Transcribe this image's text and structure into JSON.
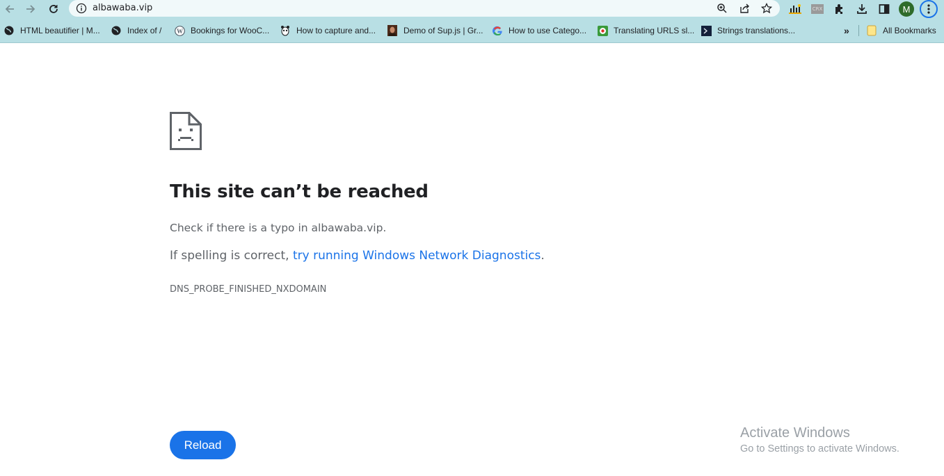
{
  "address_bar": {
    "url": "albawaba.vip"
  },
  "nav": {
    "back": "back-arrow-icon",
    "forward": "forward-arrow-icon",
    "reload": "reload-icon"
  },
  "toolbar_icons": [
    "zoom-icon",
    "share-icon",
    "star-icon",
    "analytics-extension-icon",
    "crx-extension-icon",
    "puzzle-icon",
    "download-icon",
    "side-panel-icon",
    "profile-avatar",
    "menu-icon"
  ],
  "extensions": {
    "crx_label": "CRX",
    "profile_initial": "M"
  },
  "bookmarks": [
    {
      "label": "HTML beautifier | M..."
    },
    {
      "label": "Index of /"
    },
    {
      "label": "Bookings for WooC..."
    },
    {
      "label": "How to capture and..."
    },
    {
      "label": "Demo of Sup.js | Gr..."
    },
    {
      "label": "How to use Catego..."
    },
    {
      "label": "Translating URLS sl..."
    },
    {
      "label": "Strings translations..."
    }
  ],
  "bookmarks_overflow": "»",
  "all_bookmarks": "All Bookmarks",
  "error": {
    "title": "This site can’t be reached",
    "typo_message": "Check if there is a typo in albawaba.vip.",
    "spelling_prefix": "If spelling is correct, ",
    "diagnostics_link": "try running Windows Network Diagnostics",
    "spelling_suffix": ".",
    "code": "DNS_PROBE_FINISHED_NXDOMAIN",
    "reload_label": "Reload"
  },
  "watermark": {
    "line1": "Activate Windows",
    "line2": "Go to Settings to activate Windows."
  },
  "colors": {
    "toolbar_bg": "#b8dfe4",
    "link": "#1a73e8",
    "button": "#1a73e8",
    "profile_avatar": "#2e6b2a"
  }
}
